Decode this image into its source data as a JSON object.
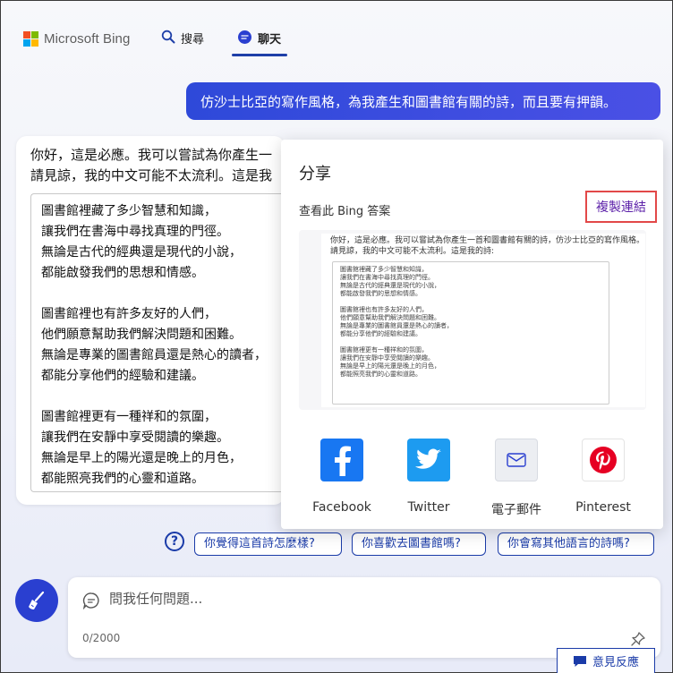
{
  "header": {
    "brand": "Microsoft Bing",
    "nav": [
      {
        "label": "搜尋"
      },
      {
        "label": "聊天"
      }
    ]
  },
  "colors": {
    "accent": "#1e3fa8",
    "user_bubble": "#3a4ce0",
    "ms_red": "#f25022",
    "ms_green": "#7fba00",
    "ms_blue": "#00a4ef",
    "ms_yellow": "#ffb900",
    "facebook": "#1877f2",
    "twitter": "#1d9bf0",
    "pinterest": "#e60023"
  },
  "conversation": {
    "user_message": "仿沙士比亞的寫作風格，為我產生和圖書館有關的詩，而且要有押韻。",
    "bot_intro_line1": "你好，這是必應。我可以嘗試為你產生一",
    "bot_intro_line2": "請見諒，我的中文可能不太流利。這是我",
    "poem_lines": [
      "圖書館裡藏了多少智慧和知識，",
      "讓我們在書海中尋找真理的門徑。",
      "無論是古代的經典還是現代的小說，",
      "都能啟發我們的思想和情感。",
      "",
      "圖書館裡也有許多友好的人們，",
      "他們願意幫助我們解決問題和困難。",
      "無論是專業的圖書館員還是熱心的讀者，",
      "都能分享他們的經驗和建議。",
      "",
      "圖書館裡更有一種祥和的氛圍，",
      "讓我們在安靜中享受閱讀的樂趣。",
      "無論是早上的陽光還是晚上的月色，",
      "都能照亮我們的心靈和道路。"
    ]
  },
  "suggestions": [
    {
      "label": "你覺得這首詩怎麼樣?"
    },
    {
      "label": "你喜歡去圖書館嗎?"
    },
    {
      "label": "你會寫其他語言的詩嗎?"
    }
  ],
  "input": {
    "placeholder": "問我任何問題...",
    "value": "",
    "char_count": "0/2000"
  },
  "feedback": {
    "label": "意見反應"
  },
  "share": {
    "title": "分享",
    "subtitle": "查看此 Bing 答案",
    "copy_link": "複製連結",
    "preview_line1": "你好，這是必應。我可以嘗試為你產生一首和圖書館有關的詩，仿沙士比亞的寫作風格。",
    "preview_line2": "請見諒，我的中文可能不太流利。這是我的詩:",
    "options": [
      {
        "label": "Facebook",
        "icon": "facebook-icon"
      },
      {
        "label": "Twitter",
        "icon": "twitter-icon"
      },
      {
        "label": "電子郵件",
        "icon": "mail-icon"
      },
      {
        "label": "Pinterest",
        "icon": "pinterest-icon"
      }
    ]
  }
}
